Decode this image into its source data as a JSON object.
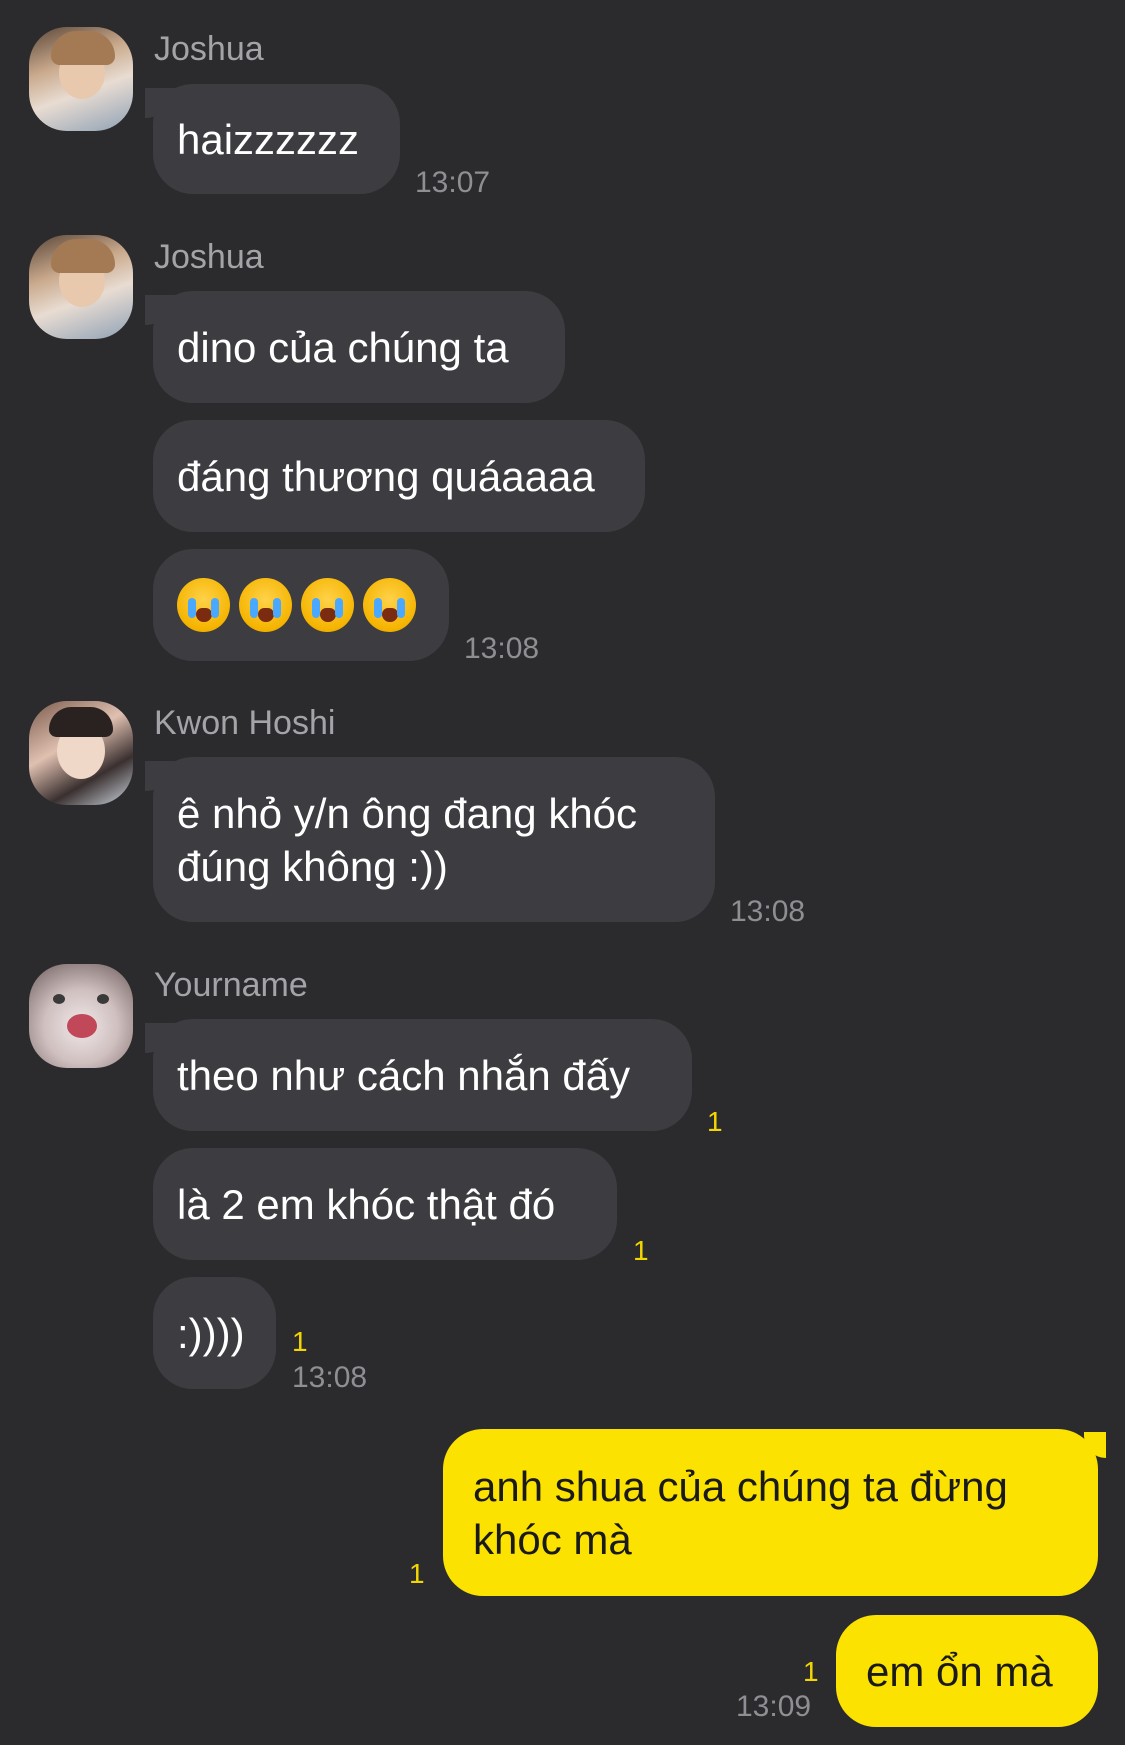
{
  "messages": {
    "g1": {
      "sender": "Joshua",
      "bubbles": [
        "haizzzzzz"
      ],
      "time": "13:07"
    },
    "g2": {
      "sender": "Joshua",
      "bubbles": [
        "dino của chúng ta",
        "đáng thương quáaaaa"
      ],
      "emoji_count": 4,
      "emoji": "loudly-crying-face",
      "time": "13:08"
    },
    "g3": {
      "sender": "Kwon Hoshi",
      "line1": "ê nhỏ y/n ông đang khóc",
      "line2": "đúng không :))",
      "time": "13:08"
    },
    "g4": {
      "sender": "Yourname",
      "bubbles": [
        "theo như cách nhắn đấy",
        "là 2 em khóc thật đó",
        ":))))"
      ],
      "unread": [
        "1",
        "1",
        "1"
      ],
      "time": "13:08"
    },
    "mine": {
      "line1": "anh shua của chúng ta đừng",
      "line2": "khóc mà",
      "unread1": "1",
      "bubble2": "em ổn mà",
      "unread2": "1",
      "time": "13:09"
    }
  },
  "colors": {
    "background": "#2b2b2e",
    "incoming_bubble": "#3d3d41",
    "outgoing_bubble": "#fbe201",
    "unread": "#f3d500",
    "meta_text": "#8e8e93"
  }
}
